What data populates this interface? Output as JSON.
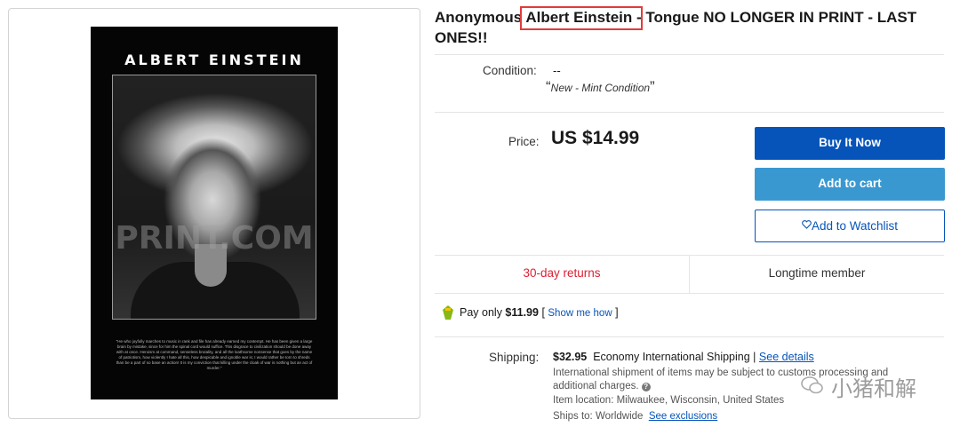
{
  "poster": {
    "title": "ALBERT EINSTEIN",
    "watermark": "PRINT.COM",
    "quote": "\"He who joyfully marches to music in rank and file has already earned my contempt. He has been given a large brain by mistake, since for him the spinal cord would suffice. This disgrace to civilization should be done away with at once. Heroism at command, senseless brutality, and all the loathsome nonsense that goes by the name of patriotism, how violently I hate all this, how despicable and ignoble war is; I would rather be torn to shreds than be a part of so base an action! It is my conviction that killing under the cloak of war is nothing but an act of murder.\""
  },
  "title": {
    "prefix": "Anonymous ",
    "highlight": "Albert Einstein -",
    "suffix": " Tongue NO LONGER IN PRINT - LAST ONES!!"
  },
  "condition": {
    "label": "Condition:",
    "value": "--",
    "open_quote": "“",
    "note": "New - Mint Condition",
    "close_quote": "”"
  },
  "price": {
    "label": "Price:",
    "value": "US $14.99"
  },
  "buttons": {
    "buy": "Buy It Now",
    "cart": "Add to cart",
    "watch": "Add to Watchlist"
  },
  "badges": {
    "returns": "30-day returns",
    "member": "Longtime member"
  },
  "paypal": {
    "text": "Pay only ",
    "amount": "$11.99",
    "bracket_open": " [ ",
    "link": "Show me how",
    "bracket_close": " ]"
  },
  "shipping": {
    "label": "Shipping:",
    "amount": "$32.95",
    "method": "Economy International Shipping",
    "sep": " | ",
    "details_link": "See details",
    "note_line1": "International shipment of items may be subject to customs processing and",
    "note_line2": "additional charges.",
    "location": "Item location:  Milwaukee, Wisconsin, United States",
    "ships_to": "Ships to:  Worldwide",
    "exclusions_link": "See exclusions"
  },
  "wechat_watermark": "小猪和解",
  "colors": {
    "buy": "#0654ba",
    "cart": "#3a98d1",
    "returns": "#dd1e31",
    "highlight_box": "#e23b3b"
  }
}
